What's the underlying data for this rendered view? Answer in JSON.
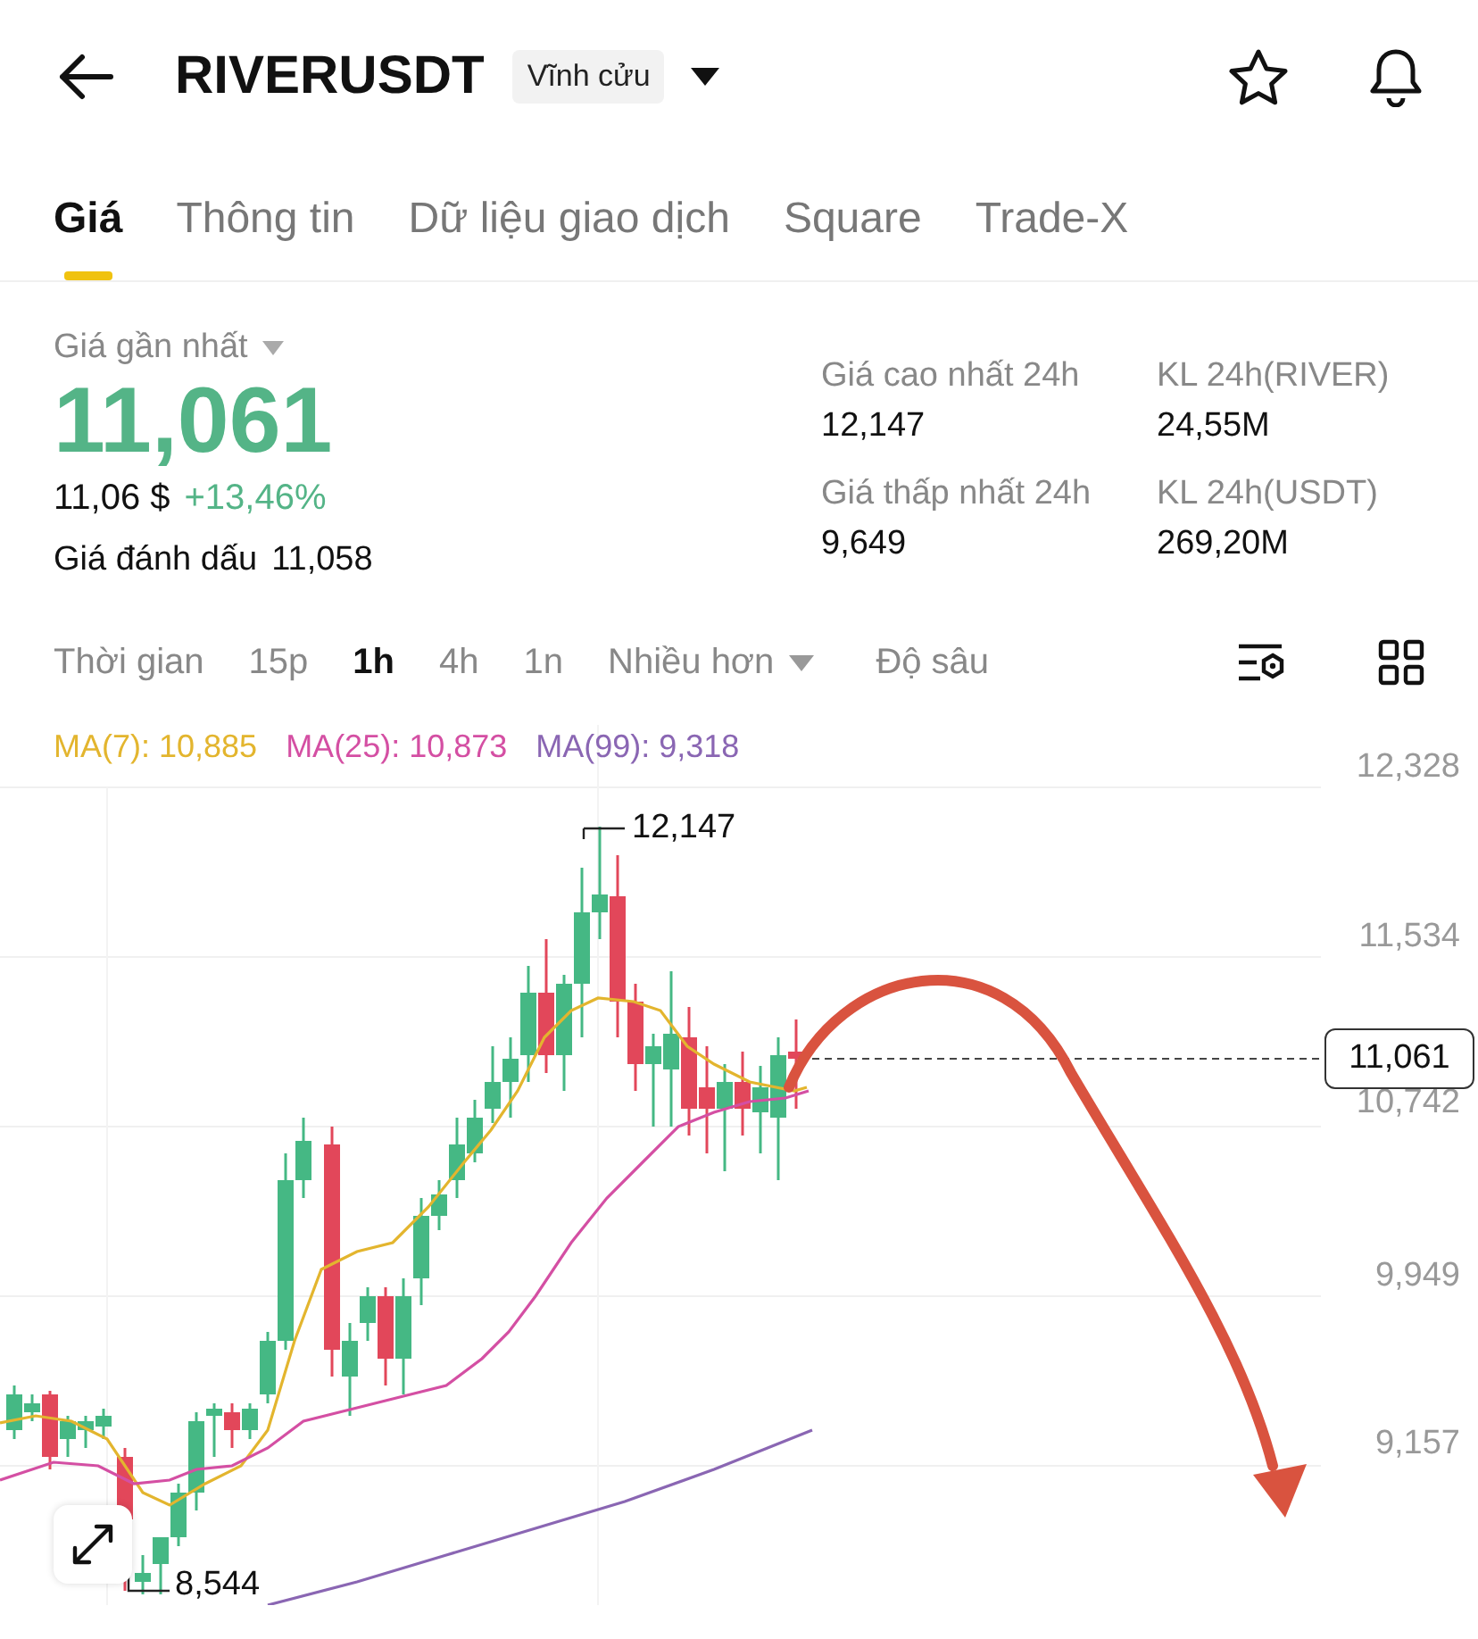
{
  "header": {
    "title": "RIVERUSDT",
    "badge": "Vĩnh cửu"
  },
  "tabs": [
    {
      "label": "Giá",
      "selected": true
    },
    {
      "label": "Thông tin",
      "selected": false
    },
    {
      "label": "Dữ liệu giao dịch",
      "selected": false
    },
    {
      "label": "Square",
      "selected": false
    },
    {
      "label": "Trade-X",
      "selected": false
    }
  ],
  "price": {
    "label": "Giá gần nhất",
    "last": "11,061",
    "usd": "11,06 $",
    "change": "+13,46%",
    "mark_label": "Giá đánh dấu",
    "mark": "11,058"
  },
  "stats": [
    {
      "label": "Giá cao nhất 24h",
      "value": "12,147"
    },
    {
      "label": "KL 24h(RIVER)",
      "value": "24,55M"
    },
    {
      "label": "Giá thấp nhất 24h",
      "value": "9,649"
    },
    {
      "label": "KL 24h(USDT)",
      "value": "269,20M"
    }
  ],
  "interval_label": "Thời gian",
  "intervals": [
    {
      "label": "15p",
      "selected": false
    },
    {
      "label": "1h",
      "selected": true
    },
    {
      "label": "4h",
      "selected": false
    },
    {
      "label": "1n",
      "selected": false
    }
  ],
  "more_label": "Nhiều hơn",
  "depth_label": "Độ sâu",
  "chart": {
    "ma": [
      {
        "label": "MA(7): 10,885",
        "color": "#e3b52e"
      },
      {
        "label": "MA(25): 10,873",
        "color": "#d44fa3"
      },
      {
        "label": "MA(99): 9,318",
        "color": "#8a66b3"
      }
    ],
    "y_labels": [
      "12,328",
      "11,534",
      "10,742",
      "9,949",
      "9,157"
    ],
    "high_label": "12,147",
    "low_label": "8,544",
    "last_price": "11,061"
  }
}
